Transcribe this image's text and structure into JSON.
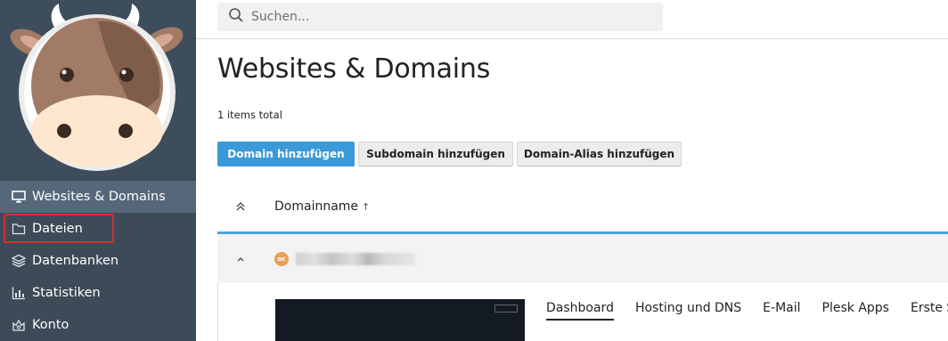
{
  "search": {
    "placeholder": "Suchen..."
  },
  "sidebar": {
    "items": [
      {
        "label": "Websites & Domains",
        "icon": "monitor-icon",
        "active": true
      },
      {
        "label": "Dateien",
        "icon": "folder-icon",
        "active": false
      },
      {
        "label": "Datenbanken",
        "icon": "database-icon",
        "active": false
      },
      {
        "label": "Statistiken",
        "icon": "bar-chart-icon",
        "active": false
      },
      {
        "label": "Konto",
        "icon": "account-icon",
        "active": false
      }
    ]
  },
  "main": {
    "title": "Websites & Domains",
    "total": "1 items total",
    "buttons": {
      "add_domain": "Domain hinzufügen",
      "add_subdomain": "Subdomain hinzufügen",
      "add_alias": "Domain-Alias hinzufügen"
    },
    "table": {
      "column": "Domainname",
      "sort_indicator": "↑"
    },
    "domain_row": {
      "favicon_text": "oc"
    },
    "tabs": [
      "Dashboard",
      "Hosting und DNS",
      "E-Mail",
      "Plesk Apps",
      "Erste Sc"
    ]
  },
  "colors": {
    "sidebar_bg": "#3d4a57",
    "sidebar_active": "#56677a",
    "primary": "#3a9ad9",
    "highlight": "#d32f2f"
  }
}
